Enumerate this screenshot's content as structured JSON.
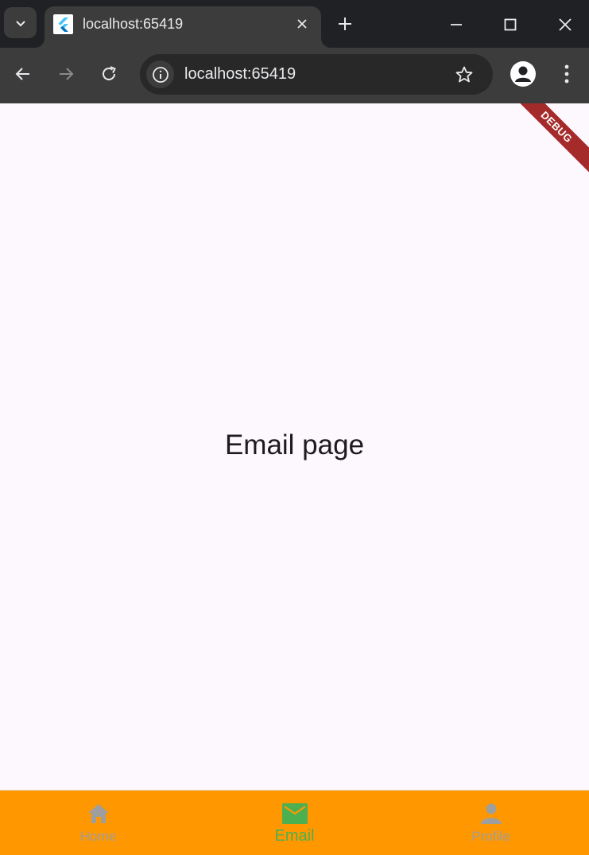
{
  "browser": {
    "tab": {
      "title": "localhost:65419",
      "favicon": "flutter-logo-icon"
    },
    "address_bar": {
      "url": "localhost:65419"
    },
    "icons": {
      "tab_search": "chevron-down-icon",
      "tab_close": "close-icon",
      "new_tab": "plus-icon",
      "minimize": "minimize-icon",
      "maximize": "maximize-icon",
      "close_window": "close-icon",
      "back": "arrow-left-icon",
      "forward": "arrow-right-icon",
      "reload": "reload-icon",
      "site_info": "info-icon",
      "bookmark": "star-icon",
      "profile": "person-icon",
      "menu": "more-vert-icon"
    }
  },
  "app": {
    "debug_banner": "DEBUG",
    "page_text": "Email page",
    "bottom_nav": {
      "background": "#ff9800",
      "selected_color": "#4caf50",
      "unselected_color": "#9e9e9e",
      "items": [
        {
          "label": "Home",
          "icon": "home-icon",
          "selected": false
        },
        {
          "label": "Email",
          "icon": "email-icon",
          "selected": true
        },
        {
          "label": "Profile",
          "icon": "person-icon",
          "selected": false
        }
      ]
    }
  }
}
